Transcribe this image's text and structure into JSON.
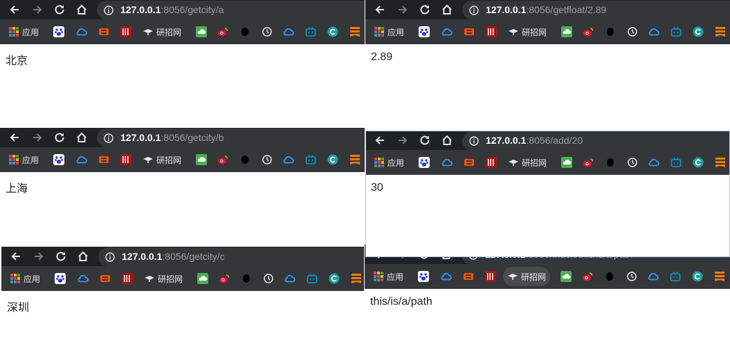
{
  "bookmarks": {
    "apps": "应用",
    "yanzhao": "研招网"
  },
  "windows": [
    {
      "host": "127.0.0.1",
      "path": ":8056/getcity/a",
      "content": "北京"
    },
    {
      "host": "127.0.0.1",
      "path": ":8056/getfloat/2.89",
      "content": "2.89"
    },
    {
      "host": "127.0.0.1",
      "path": ":8056/getcity/b",
      "content": "上海"
    },
    {
      "host": "127.0.0.1",
      "path": ":8056/add/20",
      "content": "30"
    },
    {
      "host": "127.0.0.1",
      "path": ":8056/getcity/c",
      "content": "深圳"
    },
    {
      "host": "127.0.0.1",
      "path": ":8056/index/this/is/a/path",
      "content": "this/is/a/path"
    }
  ],
  "colors": {
    "toolbar": "#202124",
    "bookmarks_bar": "#35363a",
    "omnibox": "#35363a",
    "host_text": "#ffffff",
    "path_text": "#9aa0a6"
  }
}
